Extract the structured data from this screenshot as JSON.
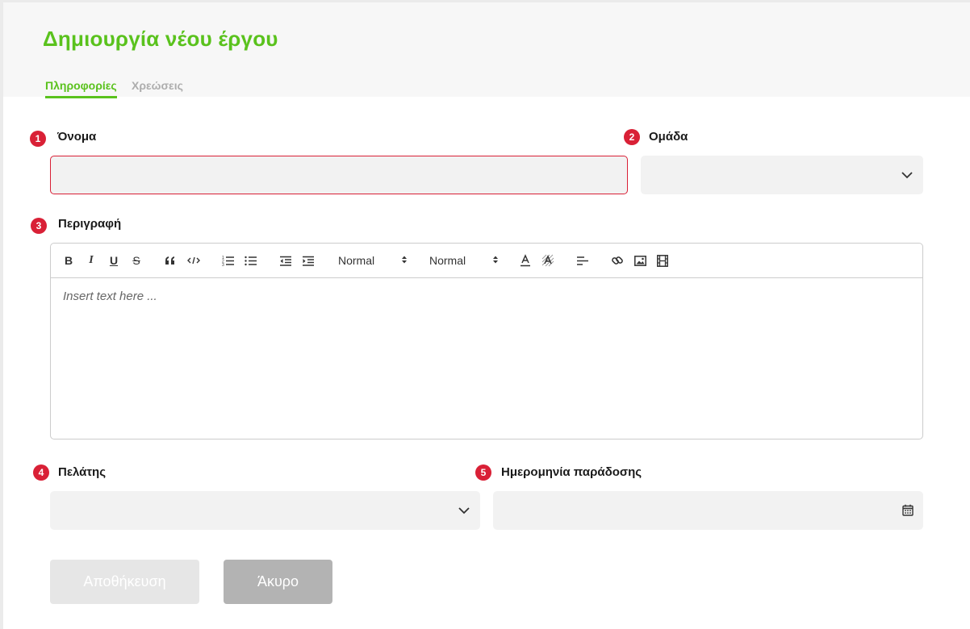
{
  "header": {
    "title": "Δημιουργία νέου έργου",
    "tabs": [
      {
        "label": "Πληροφορίες",
        "active": true
      },
      {
        "label": "Χρεώσεις",
        "active": false
      }
    ]
  },
  "form": {
    "name": {
      "badge": "1",
      "label": "Όνομα",
      "value": ""
    },
    "team": {
      "badge": "2",
      "label": "Ομάδα",
      "value": ""
    },
    "description": {
      "badge": "3",
      "label": "Περιγραφή",
      "placeholder": "Insert text here ...",
      "toolbar": {
        "font_picker": "Normal",
        "size_picker": "Normal",
        "bold": "B",
        "italic": "I",
        "underline": "U",
        "strike": "S"
      }
    },
    "client": {
      "badge": "4",
      "label": "Πελάτης",
      "value": ""
    },
    "delivery_date": {
      "badge": "5",
      "label": "Ημερομηνία παράδοσης",
      "value": ""
    }
  },
  "actions": {
    "save_label": "Αποθήκευση",
    "cancel_label": "Άκυρο"
  },
  "colors": {
    "accent": "#5ac21d",
    "badge": "#d92036",
    "error_border": "#d92036",
    "field_bg": "#f2f2f2"
  }
}
